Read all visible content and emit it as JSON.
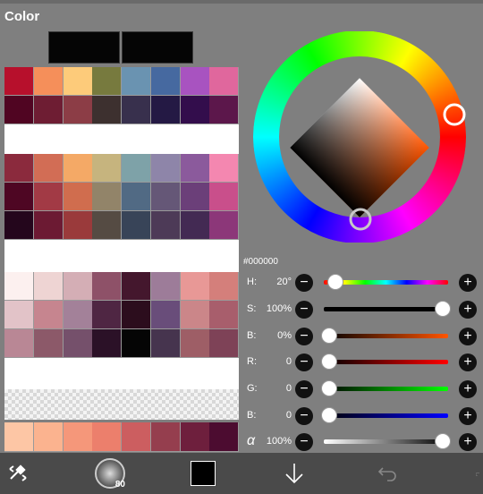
{
  "panel": {
    "title": "Color"
  },
  "current_colors": {
    "primary": "#050505",
    "secondary": "#050505"
  },
  "palette": {
    "groups": [
      [
        [
          "#b7102c",
          "#f58f5a",
          "#fdcb7a",
          "#777a3e",
          "#6a93b1",
          "#4669a0",
          "#a853c0",
          "#e0679d"
        ],
        [
          "#500522",
          "#6e1d33",
          "#8c3d46",
          "#3d302f",
          "#38304d",
          "#241944",
          "#330d4c",
          "#5c174b"
        ]
      ],
      [
        [
          "#8b2a3d",
          "#d26d55",
          "#f4a966",
          "#c6b47e",
          "#7ea2a8",
          "#8e85a9",
          "#8b5a9c",
          "#f487b0"
        ],
        [
          "#4e0623",
          "#a23a45",
          "#d06d4e",
          "#928469",
          "#516a84",
          "#655777",
          "#6b3f79",
          "#c94f8b"
        ],
        [
          "#24061c",
          "#6c1a33",
          "#9a3a3b",
          "#554b43",
          "#384458",
          "#4d3a57",
          "#432a53",
          "#8c3779"
        ]
      ],
      [
        [
          "#fcf0ef",
          "#eed4d3",
          "#d4aeb5",
          "#8e5168",
          "#44172d",
          "#9d7c99",
          "#e89896",
          "#d47f7b"
        ],
        [
          "#e2c3c8",
          "#c6858f",
          "#a38199",
          "#4f2643",
          "#2c0d1d",
          "#694d7a",
          "#cb8689",
          "#a85e6c"
        ],
        [
          "#b98795",
          "#8c5969",
          "#75506b",
          "#2b1127",
          "#050505",
          "#46344e",
          "#9e5e66",
          "#7e4257"
        ]
      ]
    ],
    "recent": [
      "#fdc6a5",
      "#fbb38f",
      "#f5977a",
      "#ec7f6c",
      "#cc5e60",
      "#953e4e",
      "#6e1f3d",
      "#4c0c30"
    ]
  },
  "picker": {
    "hex": "#000000"
  },
  "sliders": [
    {
      "id": "h",
      "label": "H:",
      "value": "20°",
      "pos": 0.09
    },
    {
      "id": "s",
      "label": "S:",
      "value": "100%",
      "pos": 0.96
    },
    {
      "id": "b",
      "label": "B:",
      "value": "0%",
      "pos": 0.04
    },
    {
      "id": "r",
      "label": "R:",
      "value": "0",
      "pos": 0.04
    },
    {
      "id": "g",
      "label": "G:",
      "value": "0",
      "pos": 0.04
    },
    {
      "id": "bl",
      "label": "B:",
      "value": "0",
      "pos": 0.04
    },
    {
      "id": "a",
      "label": "α",
      "value": "100%",
      "pos": 0.96
    }
  ],
  "toolbar": {
    "icons": [
      "swap-colors-icon",
      "brush-size-icon",
      "current-color-icon",
      "arrow-down-icon",
      "undo-icon",
      "redo-icon"
    ],
    "brush_size": "80"
  }
}
